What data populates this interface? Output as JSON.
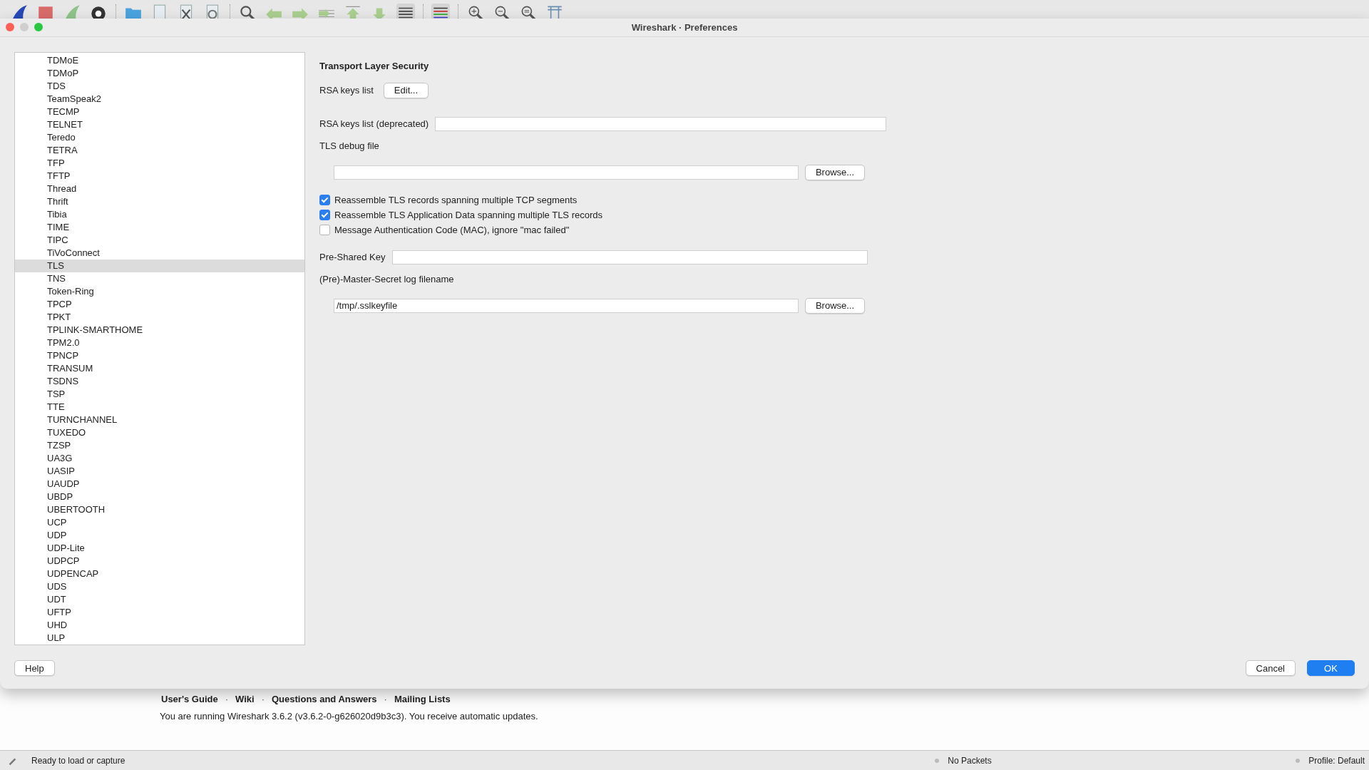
{
  "window": {
    "title": "Wireshark · Preferences"
  },
  "protocols": [
    {
      "label": "TDMoE",
      "selected": false
    },
    {
      "label": "TDMoP",
      "selected": false
    },
    {
      "label": "TDS",
      "selected": false
    },
    {
      "label": "TeamSpeak2",
      "selected": false
    },
    {
      "label": "TECMP",
      "selected": false
    },
    {
      "label": "TELNET",
      "selected": false
    },
    {
      "label": "Teredo",
      "selected": false
    },
    {
      "label": "TETRA",
      "selected": false
    },
    {
      "label": "TFP",
      "selected": false
    },
    {
      "label": "TFTP",
      "selected": false
    },
    {
      "label": "Thread",
      "selected": false
    },
    {
      "label": "Thrift",
      "selected": false
    },
    {
      "label": "Tibia",
      "selected": false
    },
    {
      "label": "TIME",
      "selected": false
    },
    {
      "label": "TIPC",
      "selected": false
    },
    {
      "label": "TiVoConnect",
      "selected": false
    },
    {
      "label": "TLS",
      "selected": true
    },
    {
      "label": "TNS",
      "selected": false
    },
    {
      "label": "Token-Ring",
      "selected": false
    },
    {
      "label": "TPCP",
      "selected": false
    },
    {
      "label": "TPKT",
      "selected": false
    },
    {
      "label": "TPLINK-SMARTHOME",
      "selected": false
    },
    {
      "label": "TPM2.0",
      "selected": false
    },
    {
      "label": "TPNCP",
      "selected": false
    },
    {
      "label": "TRANSUM",
      "selected": false
    },
    {
      "label": "TSDNS",
      "selected": false
    },
    {
      "label": "TSP",
      "selected": false
    },
    {
      "label": "TTE",
      "selected": false
    },
    {
      "label": "TURNCHANNEL",
      "selected": false
    },
    {
      "label": "TUXEDO",
      "selected": false
    },
    {
      "label": "TZSP",
      "selected": false
    },
    {
      "label": "UA3G",
      "selected": false
    },
    {
      "label": "UASIP",
      "selected": false
    },
    {
      "label": "UAUDP",
      "selected": false
    },
    {
      "label": "UBDP",
      "selected": false
    },
    {
      "label": "UBERTOOTH",
      "selected": false
    },
    {
      "label": "UCP",
      "selected": false
    },
    {
      "label": "UDP",
      "selected": false
    },
    {
      "label": "UDP-Lite",
      "selected": false
    },
    {
      "label": "UDPCP",
      "selected": false
    },
    {
      "label": "UDPENCAP",
      "selected": false
    },
    {
      "label": "UDS",
      "selected": false
    },
    {
      "label": "UDT",
      "selected": false
    },
    {
      "label": "UFTP",
      "selected": false
    },
    {
      "label": "UHD",
      "selected": false
    },
    {
      "label": "ULP",
      "selected": false
    }
  ],
  "panel": {
    "title": "Transport Layer Security",
    "rows": [
      {
        "kind": "button",
        "label": "RSA keys list",
        "button": "Edit..."
      },
      {
        "kind": "text",
        "label": "RSA keys list (deprecated)"
      },
      {
        "kind": "label",
        "label": "TLS debug file"
      },
      {
        "kind": "file",
        "button": "Browse..."
      },
      {
        "kind": "checkbox",
        "label": "Reassemble TLS records spanning multiple TCP segments",
        "checked": true
      },
      {
        "kind": "checkbox",
        "label": "Reassemble TLS Application Data spanning multiple TLS records",
        "checked": true
      },
      {
        "kind": "checkbox",
        "label": "Message Authentication Code (MAC), ignore \"mac failed\"",
        "checked": false
      },
      {
        "kind": "text",
        "label": "Pre-Shared Key"
      },
      {
        "kind": "label",
        "label": "(Pre)-Master-Secret log filename"
      },
      {
        "kind": "file",
        "value": "/tmp/.sslkeyfile",
        "button": "Browse..."
      }
    ]
  },
  "buttons": {
    "help": "Help",
    "cancel": "Cancel",
    "ok": "OK"
  },
  "links": [
    "User's Guide",
    "Wiki",
    "Questions and Answers",
    "Mailing Lists"
  ],
  "link_separator": "·",
  "version_text": "You are running Wireshark 3.6.2 (v3.6.2-0-g626020d9b3c3). You receive automatic updates.",
  "status_bar": {
    "left": "Ready to load or capture",
    "middle": "No Packets",
    "right": "Profile: Default"
  }
}
